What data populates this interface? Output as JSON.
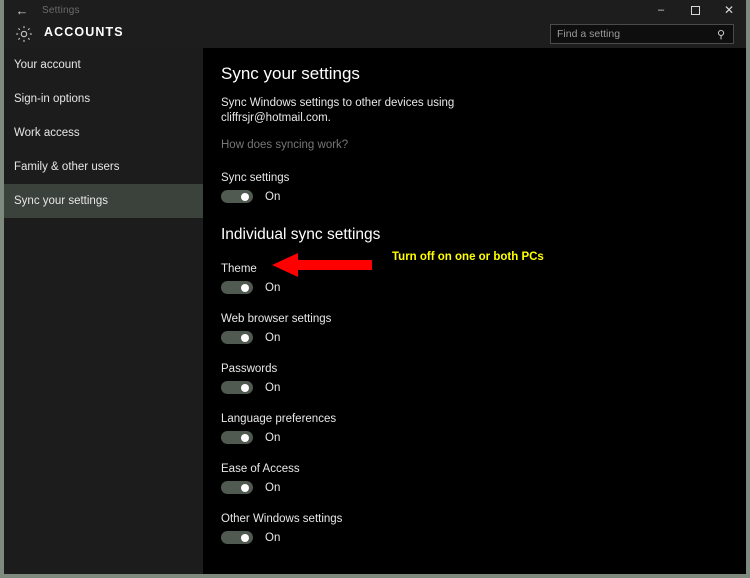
{
  "window": {
    "title": "Settings",
    "back_icon": "back-arrow-icon",
    "controls": {
      "minimize": "–",
      "maximize": "☐",
      "close": "✕"
    }
  },
  "header": {
    "gear_icon": "gear-icon",
    "app_title": "ACCOUNTS",
    "search": {
      "placeholder": "Find a setting",
      "value": "",
      "icon": "search-icon"
    }
  },
  "sidebar": {
    "items": [
      {
        "label": "Your account",
        "selected": false
      },
      {
        "label": "Sign-in options",
        "selected": false
      },
      {
        "label": "Work access",
        "selected": false
      },
      {
        "label": "Family & other users",
        "selected": false
      },
      {
        "label": "Sync your settings",
        "selected": true
      }
    ]
  },
  "main": {
    "page_title": "Sync your settings",
    "description": "Sync Windows settings to other devices using cliffrsjr@hotmail.com.",
    "help_link": "How does syncing work?",
    "master_toggle": {
      "label": "Sync settings",
      "state": "On"
    },
    "section_title": "Individual sync settings",
    "settings": [
      {
        "label": "Theme",
        "state": "On"
      },
      {
        "label": "Web browser settings",
        "state": "On"
      },
      {
        "label": "Passwords",
        "state": "On"
      },
      {
        "label": "Language preferences",
        "state": "On"
      },
      {
        "label": "Ease of Access",
        "state": "On"
      },
      {
        "label": "Other Windows settings",
        "state": "On"
      }
    ]
  },
  "annotation": {
    "text": "Turn off on one or both PCs",
    "arrow_color": "#ff0000",
    "text_color": "#ffff00"
  },
  "colors": {
    "window_border": "#7d8a7d",
    "sidebar_bg": "#1c1c1c",
    "sidebar_selected": "#3b423b",
    "main_bg": "#000000",
    "chrome_bg": "#1d1d1d",
    "toggle_track": "#505a50"
  }
}
